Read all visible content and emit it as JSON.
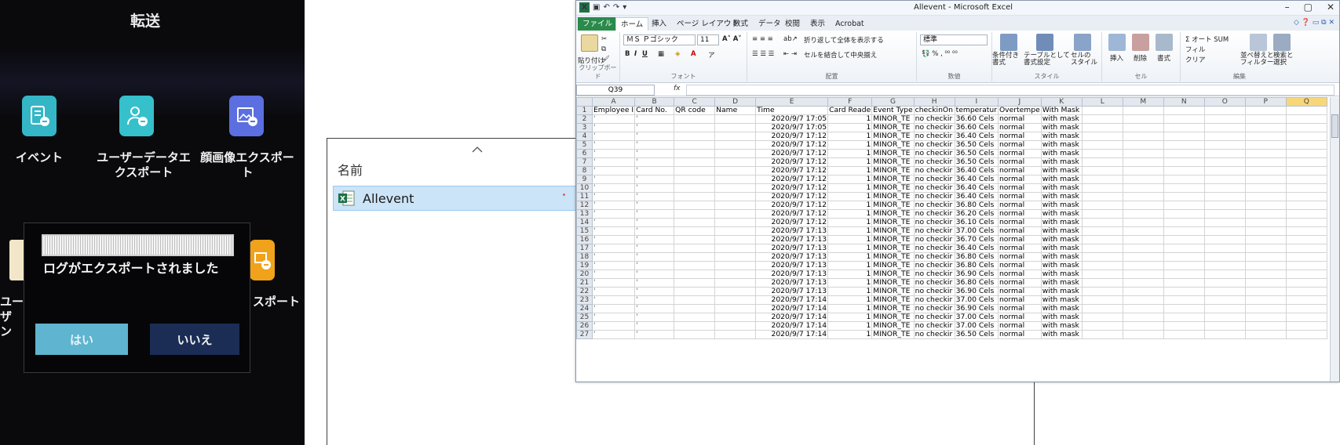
{
  "device": {
    "title": "転送",
    "icons": [
      {
        "label": "イベント",
        "icon": "event-list-icon",
        "color": "#34b6c6"
      },
      {
        "label": "ユーザーデータエ\nクスポート",
        "icon": "user-export-icon",
        "color": "#35c0cc"
      },
      {
        "label": "顔画像エクスポー\nト",
        "icon": "face-image-export-icon",
        "color": "#5b6fe0"
      },
      {
        "label": "ユーザ\nン",
        "icon": "user-import-icon",
        "color": "#f1e7c8"
      },
      {
        "label": "スポート",
        "icon": "export-icon",
        "color": "#f0a21a"
      }
    ],
    "dialog": {
      "message": "ログがエクスポートされました",
      "yes_label": "はい",
      "no_label": "いいえ",
      "progress": 1.0
    }
  },
  "explorer": {
    "column_header": "名前",
    "sort_icon": "chevron-up-icon",
    "file": {
      "name": "Allevent",
      "icon": "excel-file-icon"
    }
  },
  "excel": {
    "window_title": "Allevent - Microsoft Excel",
    "window_controls": [
      "–",
      "▢",
      "✕"
    ],
    "tabs": [
      "ファイル",
      "ホーム",
      "挿入",
      "ページ レイアウト",
      "数式",
      "データ",
      "校閲",
      "表示",
      "Acrobat"
    ],
    "active_tab": "ホーム",
    "ribbon": {
      "clipboard": {
        "paste": "貼り付け",
        "group": "クリップボード"
      },
      "font": {
        "name": "ＭＳ Ｐゴシック",
        "size": "11",
        "group": "フォント"
      },
      "alignment": {
        "wrap": "折り返して全体を表示する",
        "merge": "セルを結合して中央揃え",
        "group": "配置"
      },
      "number": {
        "format": "標準",
        "group": "数値"
      },
      "styles": {
        "conditional": "条件付き\n書式",
        "table": "テーブルとして\n書式設定",
        "cell": "セルの\nスタイル",
        "group": "スタイル"
      },
      "cells": {
        "insert": "挿入",
        "delete": "削除",
        "format": "書式",
        "group": "セル"
      },
      "editing": {
        "autosum": "Σ オート SUM",
        "fill": "フィル",
        "clear": "クリア",
        "sort": "並べ替えと\nフィルター",
        "find": "検索と\n選択",
        "group": "編集"
      }
    },
    "name_box": "Q39",
    "fx_label": "fx",
    "columns": [
      "A",
      "B",
      "C",
      "D",
      "E",
      "F",
      "G",
      "H",
      "I",
      "J",
      "K",
      "L",
      "M",
      "N",
      "O",
      "P",
      "Q"
    ],
    "selected_column": "Q",
    "header_row": [
      "Employee I",
      "Card No.",
      "QR code",
      "Name",
      "Time",
      "Card Reade",
      "Event Type",
      "checkinOn",
      "temperatur",
      "Overtempe",
      "With Mask"
    ],
    "rows": [
      {
        "time": "2020/9/7 17:05",
        "reader": "1",
        "event": "MINOR_TE",
        "check": "no checkir",
        "temp": "36.60 Cels",
        "over": "normal",
        "mask": "with mask"
      },
      {
        "time": "2020/9/7 17:05",
        "reader": "1",
        "event": "MINOR_TE",
        "check": "no checkir",
        "temp": "36.60 Cels",
        "over": "normal",
        "mask": "with mask"
      },
      {
        "time": "2020/9/7 17:12",
        "reader": "1",
        "event": "MINOR_TE",
        "check": "no checkir",
        "temp": "36.40 Cels",
        "over": "normal",
        "mask": "with mask"
      },
      {
        "time": "2020/9/7 17:12",
        "reader": "1",
        "event": "MINOR_TE",
        "check": "no checkir",
        "temp": "36.50 Cels",
        "over": "normal",
        "mask": "with mask"
      },
      {
        "time": "2020/9/7 17:12",
        "reader": "1",
        "event": "MINOR_TE",
        "check": "no checkir",
        "temp": "36.50 Cels",
        "over": "normal",
        "mask": "with mask"
      },
      {
        "time": "2020/9/7 17:12",
        "reader": "1",
        "event": "MINOR_TE",
        "check": "no checkir",
        "temp": "36.50 Cels",
        "over": "normal",
        "mask": "with mask"
      },
      {
        "time": "2020/9/7 17:12",
        "reader": "1",
        "event": "MINOR_TE",
        "check": "no checkir",
        "temp": "36.40 Cels",
        "over": "normal",
        "mask": "with mask"
      },
      {
        "time": "2020/9/7 17:12",
        "reader": "1",
        "event": "MINOR_TE",
        "check": "no checkir",
        "temp": "36.40 Cels",
        "over": "normal",
        "mask": "with mask"
      },
      {
        "time": "2020/9/7 17:12",
        "reader": "1",
        "event": "MINOR_TE",
        "check": "no checkir",
        "temp": "36.40 Cels",
        "over": "normal",
        "mask": "with mask"
      },
      {
        "time": "2020/9/7 17:12",
        "reader": "1",
        "event": "MINOR_TE",
        "check": "no checkir",
        "temp": "36.40 Cels",
        "over": "normal",
        "mask": "with mask"
      },
      {
        "time": "2020/9/7 17:12",
        "reader": "1",
        "event": "MINOR_TE",
        "check": "no checkir",
        "temp": "36.80 Cels",
        "over": "normal",
        "mask": "with mask"
      },
      {
        "time": "2020/9/7 17:12",
        "reader": "1",
        "event": "MINOR_TE",
        "check": "no checkir",
        "temp": "36.20 Cels",
        "over": "normal",
        "mask": "with mask"
      },
      {
        "time": "2020/9/7 17:12",
        "reader": "1",
        "event": "MINOR_TE",
        "check": "no checkir",
        "temp": "36.10 Cels",
        "over": "normal",
        "mask": "with mask"
      },
      {
        "time": "2020/9/7 17:13",
        "reader": "1",
        "event": "MINOR_TE",
        "check": "no checkir",
        "temp": "37.00 Cels",
        "over": "normal",
        "mask": "with mask"
      },
      {
        "time": "2020/9/7 17:13",
        "reader": "1",
        "event": "MINOR_TE",
        "check": "no checkir",
        "temp": "36.70 Cels",
        "over": "normal",
        "mask": "with mask"
      },
      {
        "time": "2020/9/7 17:13",
        "reader": "1",
        "event": "MINOR_TE",
        "check": "no checkir",
        "temp": "36.40 Cels",
        "over": "normal",
        "mask": "with mask"
      },
      {
        "time": "2020/9/7 17:13",
        "reader": "1",
        "event": "MINOR_TE",
        "check": "no checkir",
        "temp": "36.80 Cels",
        "over": "normal",
        "mask": "with mask"
      },
      {
        "time": "2020/9/7 17:13",
        "reader": "1",
        "event": "MINOR_TE",
        "check": "no checkir",
        "temp": "36.80 Cels",
        "over": "normal",
        "mask": "with mask"
      },
      {
        "time": "2020/9/7 17:13",
        "reader": "1",
        "event": "MINOR_TE",
        "check": "no checkir",
        "temp": "36.90 Cels",
        "over": "normal",
        "mask": "with mask"
      },
      {
        "time": "2020/9/7 17:13",
        "reader": "1",
        "event": "MINOR_TE",
        "check": "no checkir",
        "temp": "36.80 Cels",
        "over": "normal",
        "mask": "with mask"
      },
      {
        "time": "2020/9/7 17:13",
        "reader": "1",
        "event": "MINOR_TE",
        "check": "no checkir",
        "temp": "36.90 Cels",
        "over": "normal",
        "mask": "with mask"
      },
      {
        "time": "2020/9/7 17:14",
        "reader": "1",
        "event": "MINOR_TE",
        "check": "no checkir",
        "temp": "37.00 Cels",
        "over": "normal",
        "mask": "with mask"
      },
      {
        "time": "2020/9/7 17:14",
        "reader": "1",
        "event": "MINOR_TE",
        "check": "no checkir",
        "temp": "36.90 Cels",
        "over": "normal",
        "mask": "with mask"
      },
      {
        "time": "2020/9/7 17:14",
        "reader": "1",
        "event": "MINOR_TE",
        "check": "no checkir",
        "temp": "37.00 Cels",
        "over": "normal",
        "mask": "with mask"
      },
      {
        "time": "2020/9/7 17:14",
        "reader": "1",
        "event": "MINOR_TE",
        "check": "no checkir",
        "temp": "37.00 Cels",
        "over": "normal",
        "mask": "with mask"
      },
      {
        "time": "2020/9/7 17:14",
        "reader": "1",
        "event": "MINOR_TE",
        "check": "no checkir",
        "temp": "36.50 Cels",
        "over": "normal",
        "mask": "with mask"
      }
    ]
  }
}
